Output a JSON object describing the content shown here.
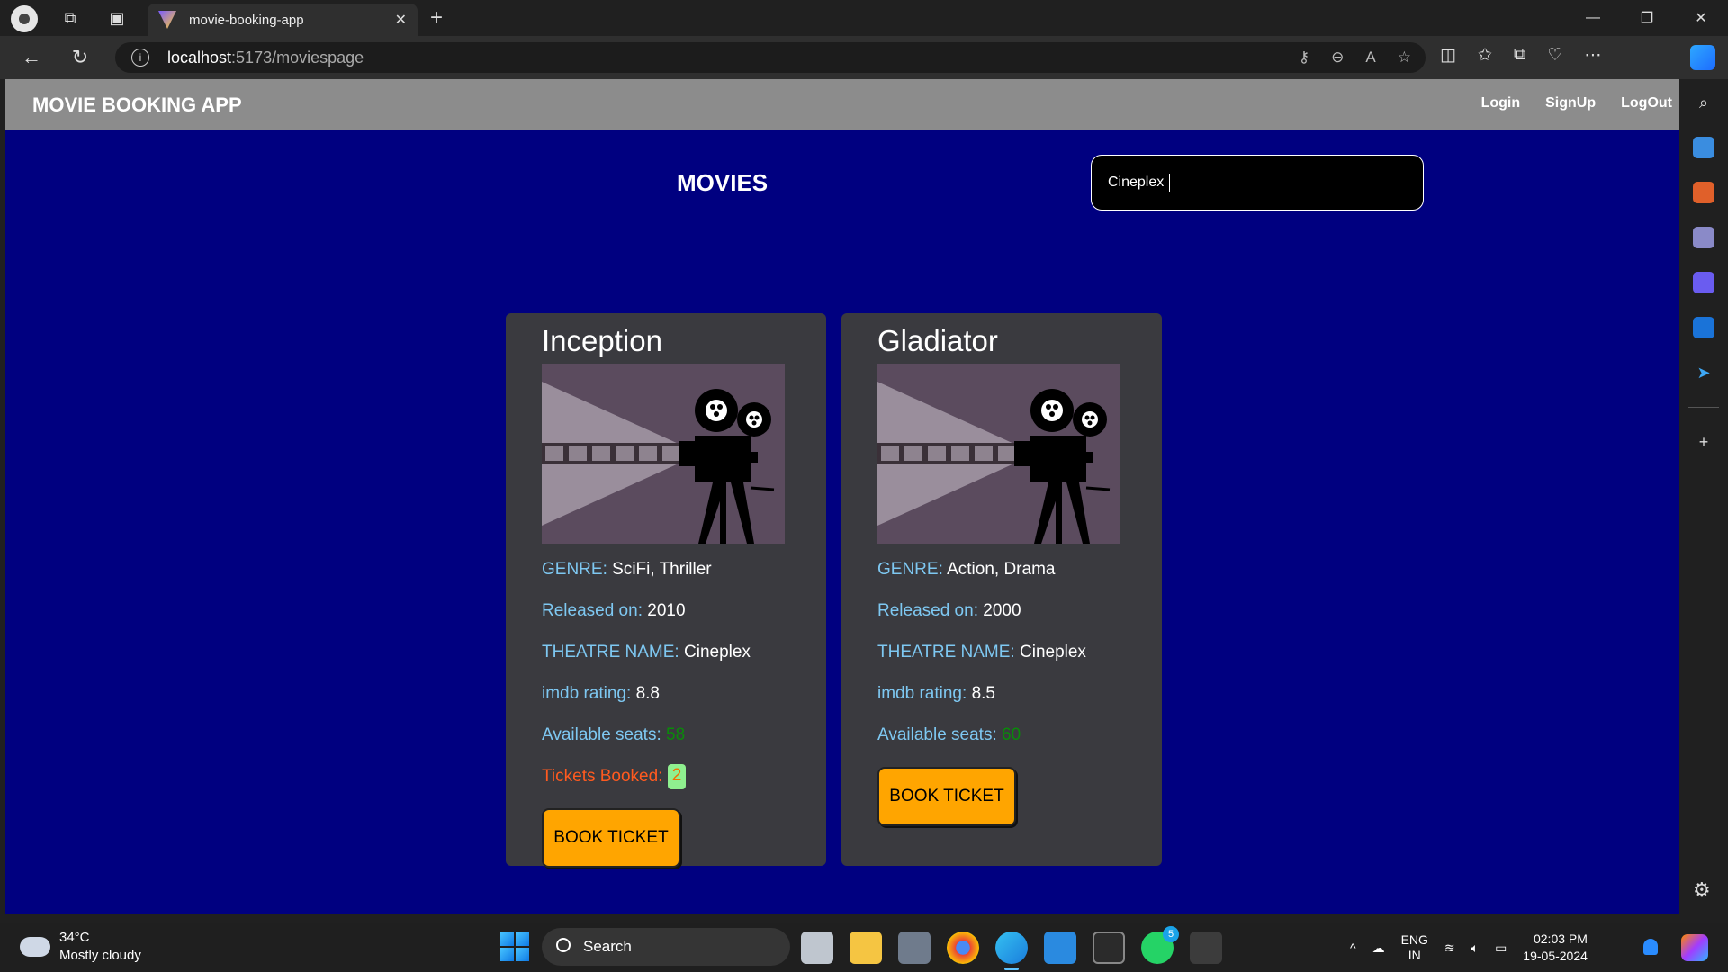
{
  "browser": {
    "tab_title": "movie-booking-app",
    "url_host": "localhost",
    "url_path": ":5173/moviespage"
  },
  "navbar": {
    "brand": "MOVIE BOOKING APP",
    "links": [
      "Login",
      "SignUp",
      "LogOut"
    ]
  },
  "main": {
    "title": "MOVIES",
    "search_value": "Cineplex"
  },
  "labels": {
    "genre": "GENRE:",
    "released": "Released on:",
    "theatre": "THEATRE NAME:",
    "rating": "imdb rating:",
    "seats": "Available seats:",
    "booked": "Tickets Booked:",
    "book_button": "BOOK TICKET"
  },
  "movies": [
    {
      "title": "Inception",
      "genre": "SciFi, Thriller",
      "released": "2010",
      "theatre": "Cineplex",
      "rating": "8.8",
      "seats": "58",
      "booked": "2"
    },
    {
      "title": "Gladiator",
      "genre": "Action, Drama",
      "released": "2000",
      "theatre": "Cineplex",
      "rating": "8.5",
      "seats": "60"
    }
  ],
  "taskbar": {
    "weather_temp": "34°C",
    "weather_text": "Mostly cloudy",
    "search_label": "Search",
    "lang1": "ENG",
    "lang2": "IN",
    "time": "02:03 PM",
    "date": "19-05-2024",
    "whatsapp_badge": "5"
  },
  "colors": {
    "page_bg": "#000080",
    "navbar_bg": "#8c8c8c",
    "card_bg": "#3a3a3f",
    "label": "#7ec8f2",
    "button": "#ffa500"
  }
}
